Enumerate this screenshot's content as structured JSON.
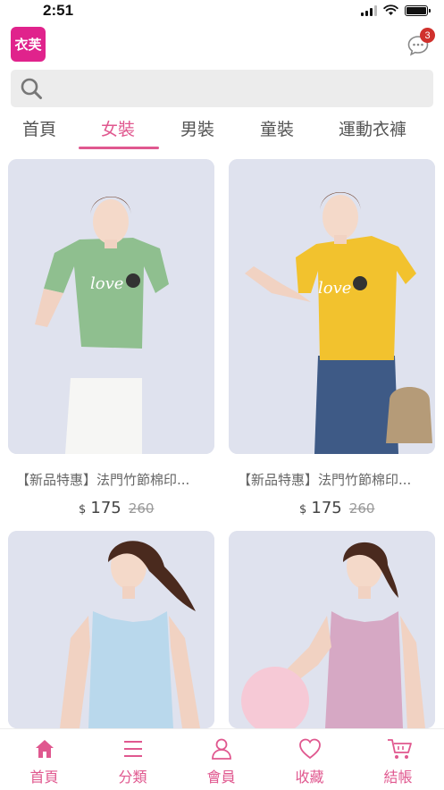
{
  "status_bar": {
    "time": "2:51"
  },
  "header": {
    "logo_text": "衣芙",
    "message_count": "3"
  },
  "search": {
    "placeholder": ""
  },
  "tabs": [
    {
      "label": "首頁"
    },
    {
      "label": "女裝"
    },
    {
      "label": "男裝"
    },
    {
      "label": "童裝"
    },
    {
      "label": "運動衣褲"
    }
  ],
  "active_tab": "女裝",
  "products": [
    {
      "title": "【新品特惠】法門竹節棉印...",
      "currency": "$",
      "price": "175",
      "original_price": "260",
      "shirt_color": "#8fbf8f",
      "bottom_color": "#f6f6f4"
    },
    {
      "title": "【新品特惠】法門竹節棉印...",
      "currency": "$",
      "price": "175",
      "original_price": "260",
      "shirt_color": "#f2c22e",
      "bottom_color": "#3e5a86"
    },
    {
      "title": "",
      "currency": "",
      "price": "",
      "original_price": "",
      "shirt_color": "#b9d8ec"
    },
    {
      "title": "",
      "currency": "",
      "price": "",
      "original_price": "",
      "shirt_color": "#d6a8c4"
    }
  ],
  "bottom_nav": [
    {
      "label": "首頁",
      "icon": "home-icon"
    },
    {
      "label": "分類",
      "icon": "menu-icon"
    },
    {
      "label": "會員",
      "icon": "user-icon"
    },
    {
      "label": "收藏",
      "icon": "heart-icon"
    },
    {
      "label": "結帳",
      "icon": "cart-icon"
    }
  ],
  "colors": {
    "accent": "#e0588f",
    "logo": "#e0238c",
    "badge": "#d0312d",
    "card_bg": "#dde0ec"
  }
}
